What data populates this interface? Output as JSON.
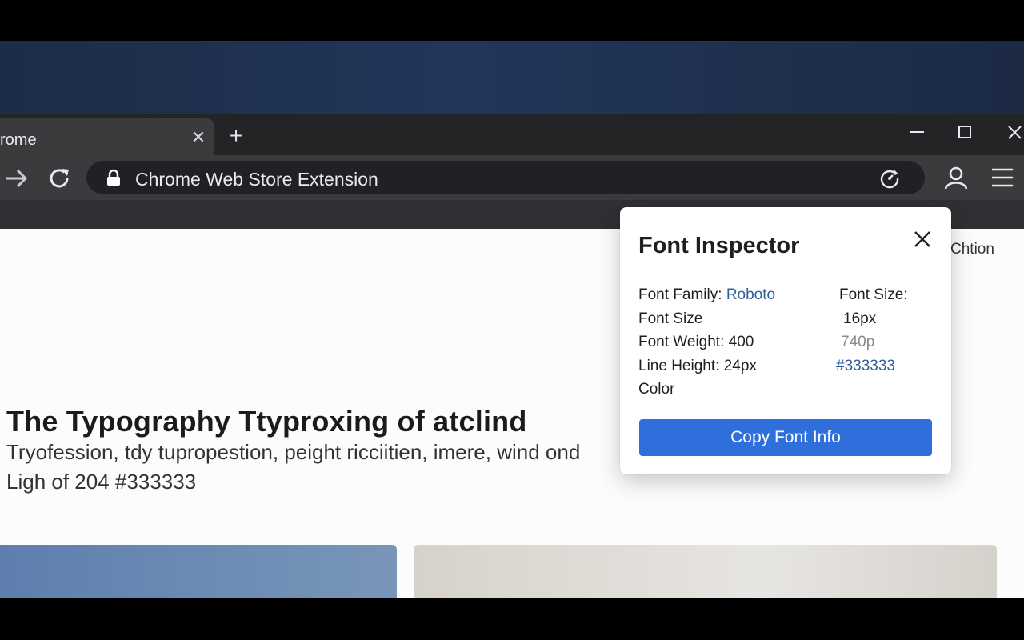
{
  "tab": {
    "title": "rome",
    "close_glyph": "✕",
    "new_tab_glyph": "+"
  },
  "toolbar": {
    "url": "Chrome Web Store Extension"
  },
  "icons": {
    "forward": "arrow-right-icon",
    "reload": "reload-icon",
    "lock": "lock-icon",
    "extension": "extension-timer-icon",
    "profile": "profile-icon",
    "menu": "hamburger-menu-icon",
    "window_minimize": "minimize-icon",
    "window_maximize": "maximize-icon",
    "window_close": "close-icon"
  },
  "page": {
    "headline": "The Typography Ttyproxing of atclind",
    "body_line1": "Tryofession, tdy tupropestion, peight ricciitien, imere, wind ond",
    "body_line2": "Ligh of 204 #333333",
    "side_text": "Chtion"
  },
  "popup": {
    "title": "Font Inspector",
    "rows_left": [
      {
        "label": "Font Family: ",
        "value": "Roboto"
      },
      {
        "label": "Font Size",
        "value": ""
      },
      {
        "label": "Font Weight: 400",
        "value": ""
      },
      {
        "label": "Line Height: 24px",
        "value": ""
      },
      {
        "label": "Color",
        "value": ""
      }
    ],
    "rows_right": [
      "Font Size:",
      "16px",
      "740p",
      "#333333"
    ],
    "copy_button": "Copy Font Info"
  },
  "colors": {
    "accent": "#2f6fdb",
    "link": "#2f5f9e",
    "chrome_dark": "#232425",
    "toolbar": "#3a3b3d",
    "text": "#333333"
  }
}
